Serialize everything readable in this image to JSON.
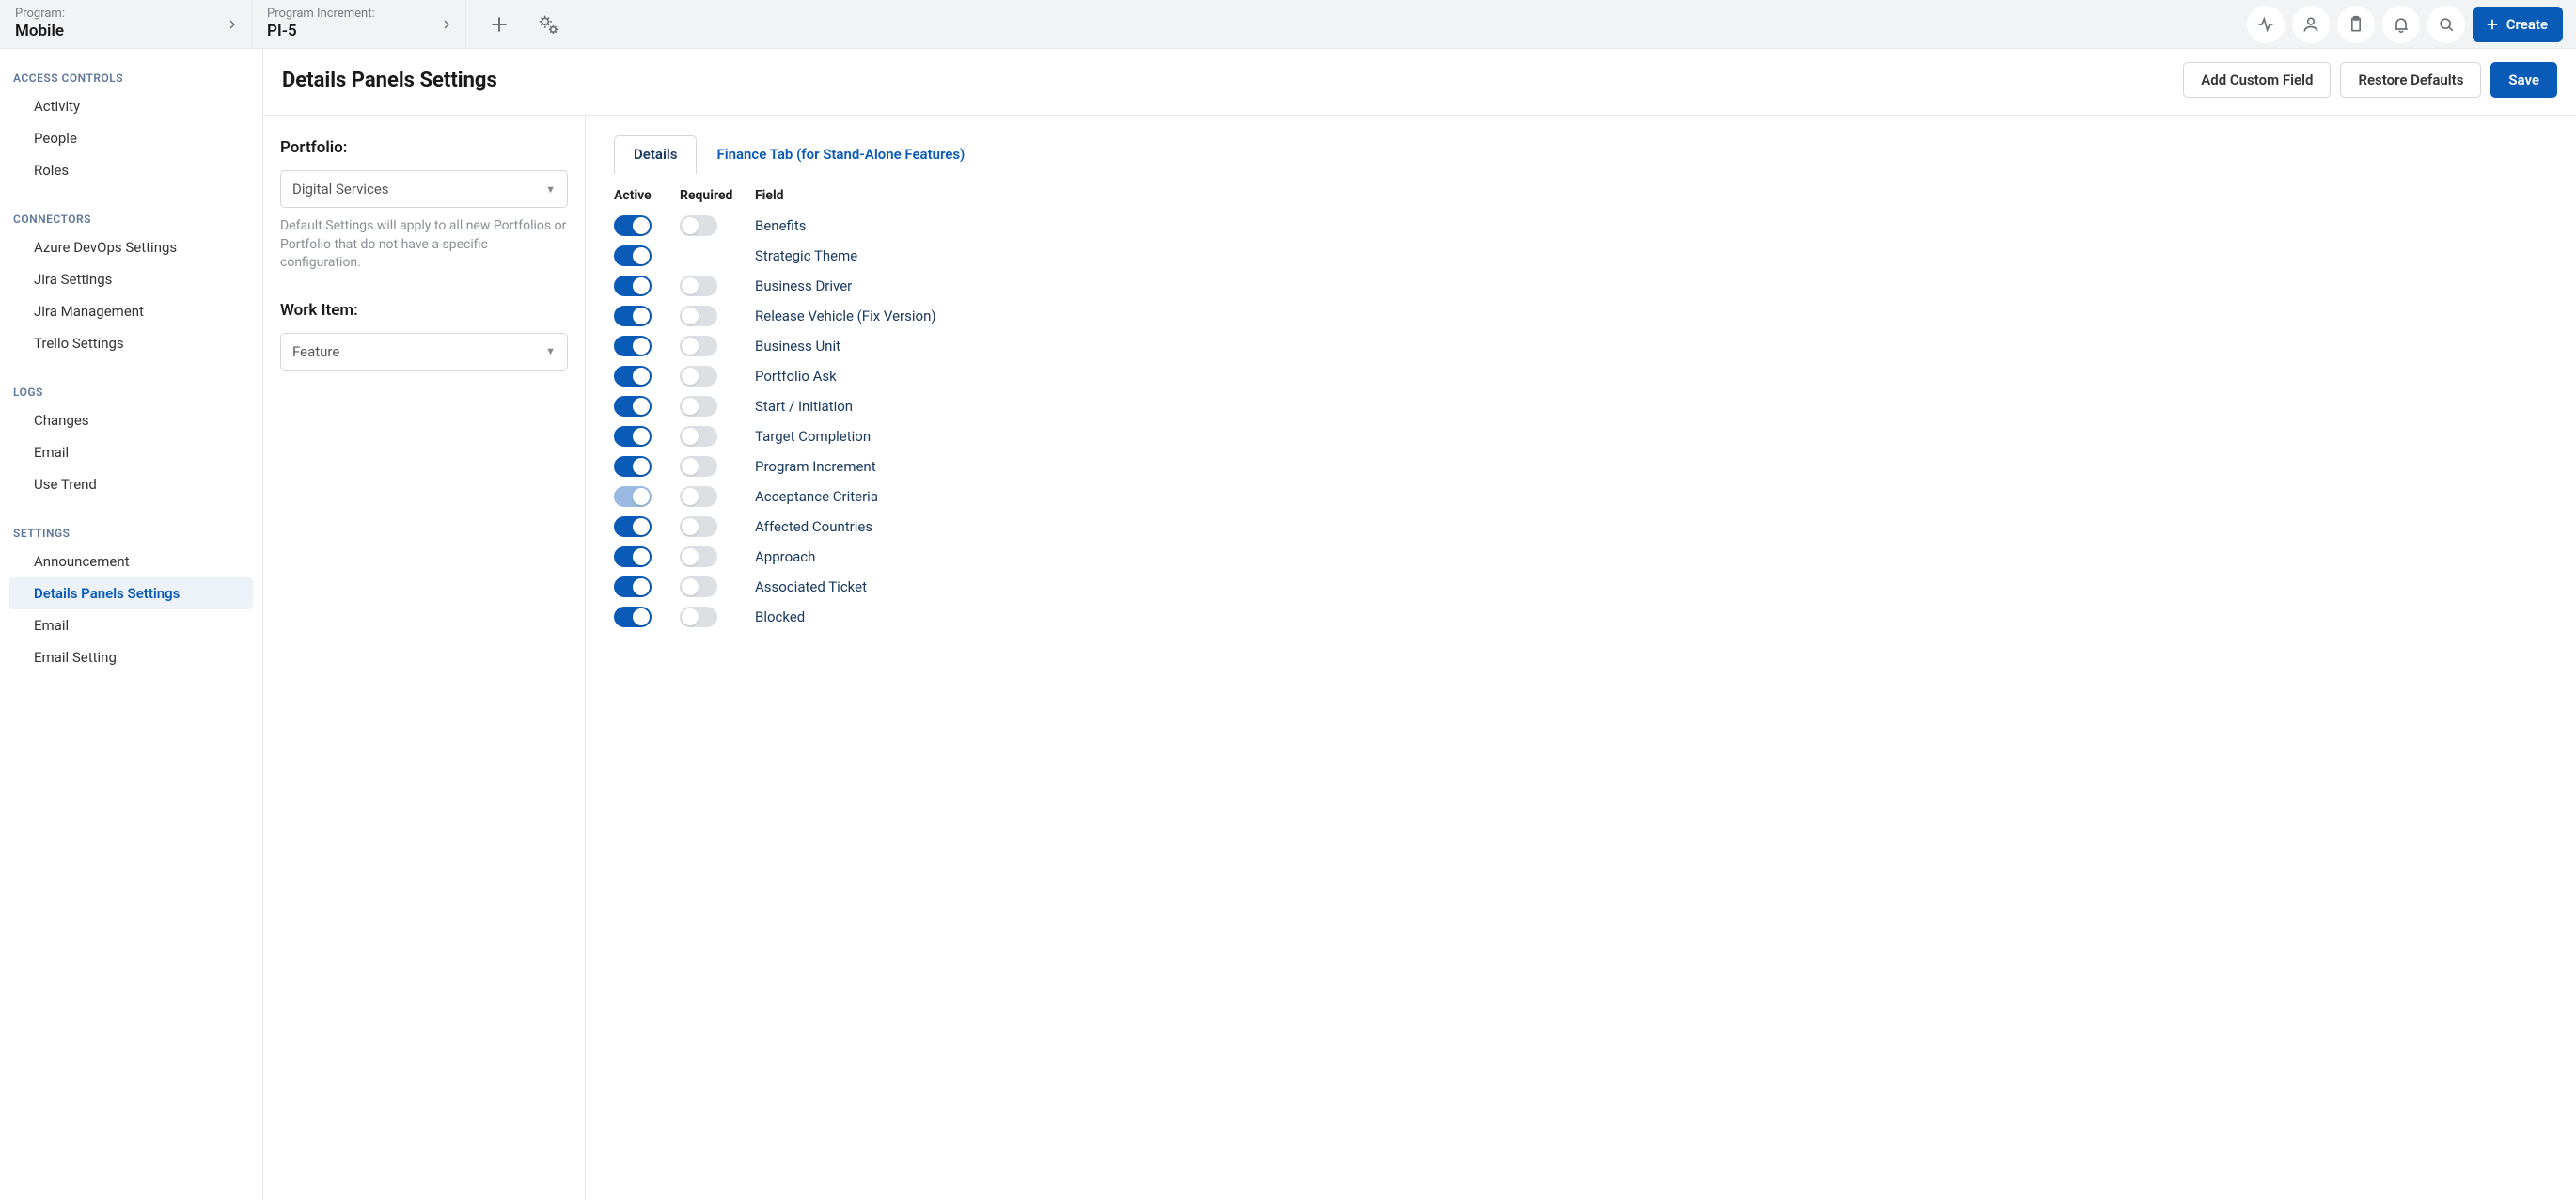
{
  "topbar": {
    "program_label": "Program:",
    "program_value": "Mobile",
    "pi_label": "Program Increment:",
    "pi_value": "PI-5",
    "create_label": "Create"
  },
  "sidebar": {
    "groups": [
      {
        "title": "ACCESS CONTROLS",
        "items": [
          "Activity",
          "People",
          "Roles"
        ]
      },
      {
        "title": "CONNECTORS",
        "items": [
          "Azure DevOps Settings",
          "Jira Settings",
          "Jira Management",
          "Trello Settings"
        ]
      },
      {
        "title": "LOGS",
        "items": [
          "Changes",
          "Email",
          "Use Trend"
        ]
      },
      {
        "title": "SETTINGS",
        "items": [
          "Announcement",
          "Details Panels Settings",
          "Email",
          "Email Setting"
        ]
      }
    ],
    "active_item": "Details Panels Settings"
  },
  "main": {
    "title": "Details Panels Settings",
    "actions": {
      "add_custom_field": "Add Custom Field",
      "restore_defaults": "Restore Defaults",
      "save": "Save"
    }
  },
  "config": {
    "portfolio_label": "Portfolio:",
    "portfolio_value": "Digital Services",
    "portfolio_help": "Default Settings will apply to all new Portfolios or Portfolio that do not have a specific configuration.",
    "workitem_label": "Work Item:",
    "workitem_value": "Feature"
  },
  "tabs": [
    "Details",
    "Finance Tab (for Stand-Alone Features)"
  ],
  "active_tab": "Details",
  "column_headers": {
    "active": "Active",
    "required": "Required",
    "field": "Field"
  },
  "fields": [
    {
      "name": "Benefits",
      "active": true,
      "required": false,
      "required_visible": true
    },
    {
      "name": "Strategic Theme",
      "active": true,
      "required": null,
      "required_visible": false
    },
    {
      "name": "Business Driver",
      "active": true,
      "required": false,
      "required_visible": true
    },
    {
      "name": "Release Vehicle (Fix Version)",
      "active": true,
      "required": false,
      "required_visible": true
    },
    {
      "name": "Business Unit",
      "active": true,
      "required": false,
      "required_visible": true
    },
    {
      "name": "Portfolio Ask",
      "active": true,
      "required": false,
      "required_visible": true
    },
    {
      "name": "Start / Initiation",
      "active": true,
      "required": false,
      "required_visible": true
    },
    {
      "name": "Target Completion",
      "active": true,
      "required": false,
      "required_visible": true
    },
    {
      "name": "Program Increment",
      "active": true,
      "required": false,
      "required_visible": true
    },
    {
      "name": "Acceptance Criteria",
      "active": true,
      "active_disabled": true,
      "required": false,
      "required_visible": true
    },
    {
      "name": "Affected Countries",
      "active": true,
      "required": false,
      "required_visible": true
    },
    {
      "name": "Approach",
      "active": true,
      "required": false,
      "required_visible": true
    },
    {
      "name": "Associated Ticket",
      "active": true,
      "required": false,
      "required_visible": true
    },
    {
      "name": "Blocked",
      "active": true,
      "required": false,
      "required_visible": true
    }
  ]
}
